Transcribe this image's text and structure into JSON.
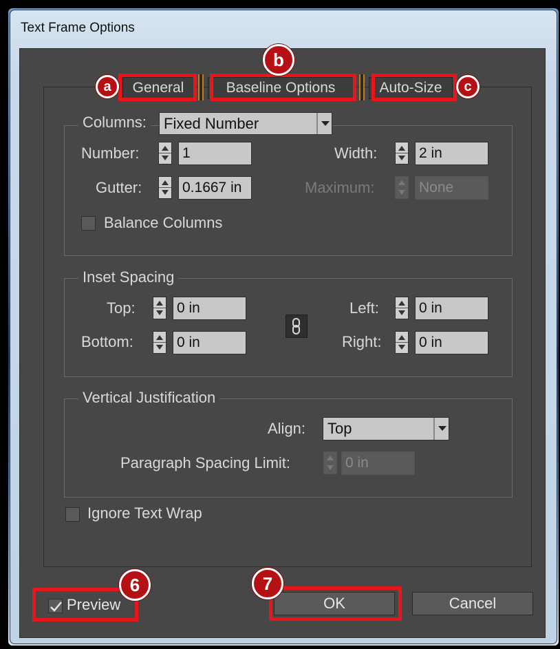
{
  "window": {
    "title": "Text Frame Options"
  },
  "tabs": [
    {
      "label": "General",
      "badge": "a"
    },
    {
      "label": "Baseline Options",
      "badge": "b"
    },
    {
      "label": "Auto-Size",
      "badge": "c"
    }
  ],
  "columns": {
    "legend": "Columns:",
    "type_value": "Fixed Number",
    "number_label": "Number:",
    "number_value": "1",
    "width_label": "Width:",
    "width_value": "2 in",
    "gutter_label": "Gutter:",
    "gutter_value": "0.1667 in",
    "maximum_label": "Maximum:",
    "maximum_value": "None",
    "balance_label": "Balance Columns"
  },
  "inset": {
    "legend": "Inset Spacing",
    "top_label": "Top:",
    "top_value": "0 in",
    "bottom_label": "Bottom:",
    "bottom_value": "0 in",
    "left_label": "Left:",
    "left_value": "0 in",
    "right_label": "Right:",
    "right_value": "0 in",
    "link_icon": "chain-link-icon"
  },
  "vertical": {
    "legend": "Vertical Justification",
    "align_label": "Align:",
    "align_value": "Top",
    "para_label": "Paragraph Spacing Limit:",
    "para_value": "0 in"
  },
  "ignore_wrap_label": "Ignore Text Wrap",
  "footer": {
    "preview_label": "Preview",
    "preview_checked": true,
    "ok_label": "OK",
    "cancel_label": "Cancel",
    "preview_badge": "6",
    "ok_badge": "7"
  },
  "colors": {
    "highlight": "#e8161b",
    "badge": "#b51115",
    "dialog_bg": "#474747"
  }
}
